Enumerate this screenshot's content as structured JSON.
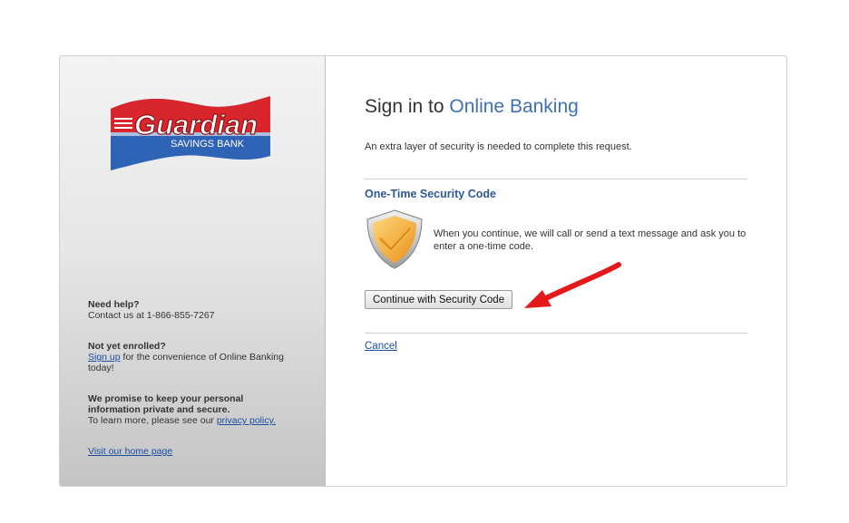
{
  "brand": {
    "name_line1": "Guardian",
    "name_line2": "SAVINGS BANK"
  },
  "sidebar": {
    "help_heading": "Need help?",
    "help_contact": "Contact us at 1-866-855-7267",
    "enroll_heading": "Not yet enrolled?",
    "enroll_link": "Sign up",
    "enroll_text": " for the convenience of Online Banking today!",
    "privacy_heading_line1": "We promise to keep your personal",
    "privacy_heading_line2": "information private and secure.",
    "privacy_text": "To learn more, please see our ",
    "privacy_link": "privacy policy.",
    "home_link": "Visit our home page"
  },
  "main": {
    "title_prefix": "Sign in to ",
    "title_accent": "Online Banking",
    "intro": "An extra layer of security is needed to complete this request.",
    "section_title": "One-Time Security Code",
    "description": "When you continue, we will call or send a text message and ask you to enter a one-time code.",
    "continue_button": "Continue with Security Code",
    "cancel_link": "Cancel"
  },
  "colors": {
    "accent": "#3f6fb5",
    "section_title": "#2d5a94",
    "link": "#1a4ea3",
    "flag_red": "#d8262c",
    "flag_blue": "#2f63b5",
    "shield_orange": "#f4a52a",
    "arrow_red": "#e3191b"
  },
  "icons": {
    "logo": "guardian-flag-logo",
    "shield": "shield-check-icon",
    "arrow": "red-arrow-icon"
  }
}
